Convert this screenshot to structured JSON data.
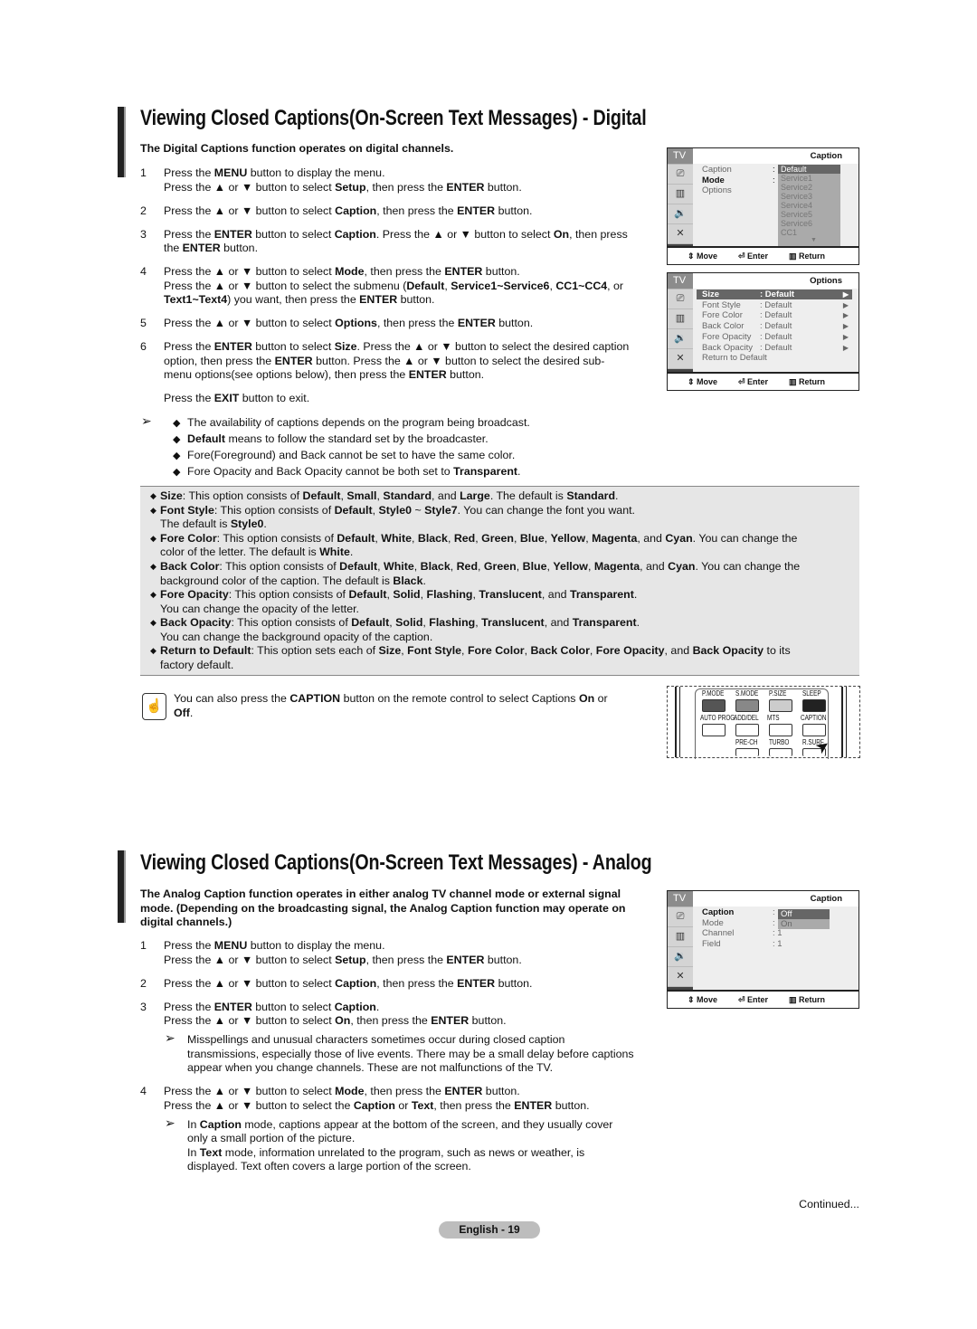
{
  "digital": {
    "title": "Viewing Closed Captions(On-Screen Text Messages) - Digital",
    "intro": "The Digital Captions function operates on digital channels.",
    "steps": [
      {
        "num": "1",
        "lines": [
          [
            "Press the ",
            "MENU",
            " button to display the menu."
          ],
          [
            "Press the ▲ or ▼ button to select ",
            "Setup",
            ", then press the ",
            "ENTER",
            " button."
          ]
        ]
      },
      {
        "num": "2",
        "lines": [
          [
            "Press the ▲ or ▼ button to select ",
            "Caption",
            ", then press the ",
            "ENTER",
            " button."
          ]
        ]
      },
      {
        "num": "3",
        "lines": [
          [
            "Press the ",
            "ENTER",
            " button to select ",
            "Caption",
            ". Press the ▲ or ▼ button to select ",
            "On",
            ", then press"
          ],
          [
            "the ",
            "ENTER",
            " button."
          ]
        ]
      },
      {
        "num": "4",
        "lines": [
          [
            "Press the ▲ or ▼ button to select ",
            "Mode",
            ", then press the ",
            "ENTER",
            " button."
          ],
          [
            "Press the ▲ or ▼ button to select the submenu (",
            "Default",
            ", ",
            "Service1~Service6",
            ", ",
            "CC1~CC4",
            ", or"
          ],
          [
            "",
            "Text1~Text4",
            ") you want, then press the ",
            "ENTER",
            " button."
          ]
        ]
      },
      {
        "num": "5",
        "lines": [
          [
            "Press the ▲ or ▼ button to select ",
            "Options",
            ", then press the ",
            "ENTER",
            " button."
          ]
        ]
      },
      {
        "num": "6",
        "lines": [
          [
            "Press the ",
            "ENTER",
            " button to select ",
            "Size",
            ". Press the ▲ or ▼ button to select the desired caption"
          ],
          [
            "option, then press the ",
            "ENTER",
            " button. Press the ▲ or ▼ button to select the desired sub-"
          ],
          [
            "menu options(see options below), then press the ",
            "ENTER",
            " button."
          ]
        ]
      },
      {
        "num": "",
        "lines": [
          [
            "Press the ",
            "EXIT",
            " button to exit."
          ]
        ]
      }
    ],
    "notes": [
      [
        "The availability of captions depends on the program being broadcast."
      ],
      [
        "",
        "Default",
        " means to follow the standard set by the broadcaster."
      ],
      [
        "Fore(Foreground) and Back cannot be set to have the same color."
      ],
      [
        "Fore Opacity and Back Opacity cannot be both set to ",
        "Transparent",
        "."
      ]
    ],
    "options": [
      [
        [
          "",
          "Size",
          ": This option consists of ",
          "Default",
          ", ",
          "Small",
          ", ",
          "Standard",
          ", and ",
          "Large",
          ". The default is ",
          "Standard",
          "."
        ]
      ],
      [
        [
          "",
          "Font Style",
          ": This option consists of ",
          "Default",
          ", ",
          "Style0",
          " ~ ",
          "Style7",
          ". You can change the font you want."
        ],
        [
          "The default is ",
          "Style0",
          "."
        ]
      ],
      [
        [
          "",
          "Fore Color",
          ": This option consists of ",
          "Default",
          ", ",
          "White",
          ", ",
          "Black",
          ", ",
          "Red",
          ", ",
          "Green",
          ", ",
          "Blue",
          ", ",
          "Yellow",
          ", ",
          "Magenta",
          ", and ",
          "Cyan",
          ". You can change the"
        ],
        [
          "color of the letter. The default is ",
          "White",
          "."
        ]
      ],
      [
        [
          "",
          "Back Color",
          ": This option consists of ",
          "Default",
          ", ",
          "White",
          ", ",
          "Black",
          ", ",
          "Red",
          ", ",
          "Green",
          ", ",
          "Blue",
          ", ",
          "Yellow",
          ", ",
          "Magenta",
          ", and ",
          "Cyan",
          ". You can change the"
        ],
        [
          "background color of the caption. The default is ",
          "Black",
          "."
        ]
      ],
      [
        [
          "",
          "Fore Opacity",
          ": This option consists of ",
          "Default",
          ", ",
          "Solid",
          ", ",
          "Flashing",
          ", ",
          "Translucent",
          ", and ",
          "Transparent",
          "."
        ],
        [
          "You can change the opacity of the letter."
        ]
      ],
      [
        [
          "",
          "Back Opacity",
          ": This option consists of ",
          "Default",
          ", ",
          "Solid",
          ", ",
          "Flashing",
          ", ",
          "Translucent",
          ", and ",
          "Transparent",
          "."
        ],
        [
          "You can change the background opacity of the caption."
        ]
      ],
      [
        [
          "",
          "Return to Default",
          ": This option sets each of ",
          "Size",
          ", ",
          "Font Style",
          ", ",
          "Fore Color",
          ", ",
          "Back Color",
          ", ",
          "Fore Opacity",
          ", and ",
          "Back Opacity",
          " to its"
        ],
        [
          "factory default."
        ]
      ]
    ],
    "hint": [
      [
        "You can also press the ",
        "CAPTION",
        " button on the remote control to select Captions ",
        "On",
        " or"
      ],
      [
        "",
        "Off",
        "."
      ]
    ],
    "remote": {
      "row1": [
        "P.MODE",
        "S.MODE",
        "P.SIZE",
        "SLEEP"
      ],
      "row1_colors": [
        "#555555",
        "#888888",
        "#cccccc",
        "#222222"
      ],
      "row2": [
        "AUTO PROG.",
        "ADD/DEL",
        "MTS",
        "CAPTION"
      ],
      "row3": [
        "PRE-CH",
        "TURBO",
        "R.SURF"
      ]
    }
  },
  "menus": {
    "footer": {
      "move": "Move",
      "enter": "Enter",
      "return": "Return"
    },
    "tv_label": "TV",
    "sidebar_icons": [
      "input-icon",
      "picture-icon",
      "sound-icon",
      "channel-icon",
      "setup-icon"
    ],
    "caption_digital": {
      "title": "Caption",
      "rows": [
        {
          "label": "Caption",
          "sep": ":",
          "bold": false
        },
        {
          "label": "Mode",
          "sep": ":",
          "bold": true
        },
        {
          "label": "Options",
          "sep": "",
          "bold": false
        }
      ],
      "dropdown": [
        "Default",
        "Service1",
        "Service2",
        "Service3",
        "Service4",
        "Service5",
        "Service6",
        "CC1"
      ],
      "selected": "Default"
    },
    "options": {
      "title": "Options",
      "rows": [
        {
          "label": "Size",
          "value": ": Default"
        },
        {
          "label": "Font Style",
          "value": ": Default"
        },
        {
          "label": "Fore Color",
          "value": ": Default"
        },
        {
          "label": "Back Color",
          "value": ": Default"
        },
        {
          "label": "Fore Opacity",
          "value": ": Default"
        },
        {
          "label": "Back Opacity",
          "value": ": Default"
        },
        {
          "label": "Return to Default",
          "value": ""
        }
      ],
      "selected": "Size"
    },
    "caption_analog": {
      "title": "Caption",
      "rows": [
        {
          "label": "Caption",
          "value": ":",
          "bold": true
        },
        {
          "label": "Mode",
          "value": ":",
          "bold": false
        },
        {
          "label": "Channel",
          "value": ": 1",
          "bold": false
        },
        {
          "label": "Field",
          "value": ": 1",
          "bold": false
        }
      ],
      "dropdown": [
        "Off",
        "On"
      ],
      "selected": "Off"
    }
  },
  "analog": {
    "title": "Viewing Closed Captions(On-Screen Text Messages) - Analog",
    "intro": [
      "The Analog Caption function operates in either analog TV channel mode or external signal",
      "mode. (Depending on the broadcasting signal, the Analog Caption function may operate on",
      "digital channels.)"
    ],
    "steps": [
      {
        "num": "1",
        "lines": [
          [
            "Press the ",
            "MENU",
            " button to display the menu."
          ],
          [
            "Press the ▲ or ▼ button to select ",
            "Setup",
            ", then press the ",
            "ENTER",
            " button."
          ]
        ]
      },
      {
        "num": "2",
        "lines": [
          [
            "Press the ▲ or ▼ button to select ",
            "Caption",
            ", then press the ",
            "ENTER",
            " button."
          ]
        ]
      },
      {
        "num": "3",
        "lines": [
          [
            "Press the ",
            "ENTER",
            " button to select ",
            "Caption",
            "."
          ],
          [
            "Press the ▲ or ▼ button to select ",
            "On",
            ", then press the ",
            "ENTER",
            " button."
          ]
        ]
      },
      {
        "num": "4",
        "lines": [
          [
            "Press the ▲ or ▼ button to select ",
            "Mode",
            ", then press the ",
            "ENTER",
            " button."
          ],
          [
            "Press the ▲ or ▼ button to select the ",
            "Caption",
            " or ",
            "Text",
            ", then press the ",
            "ENTER",
            " button."
          ]
        ]
      }
    ],
    "note3": [
      [
        "Misspellings and unusual characters sometimes occur during closed caption"
      ],
      [
        "transmissions, especially those of live events. There may be a small delay before captions"
      ],
      [
        "appear when you change channels. These are not malfunctions of the TV."
      ]
    ],
    "note4": [
      [
        "In ",
        "Caption",
        " mode, captions appear at the bottom of the screen, and they usually cover"
      ],
      [
        "only a small portion of the picture."
      ],
      [
        "In ",
        "Text",
        " mode, information unrelated to the program, such as news or weather, is"
      ],
      [
        "displayed.  Text often covers a large portion of the screen."
      ]
    ]
  },
  "footer": {
    "continued": "Continued...",
    "page": "English - 19"
  }
}
